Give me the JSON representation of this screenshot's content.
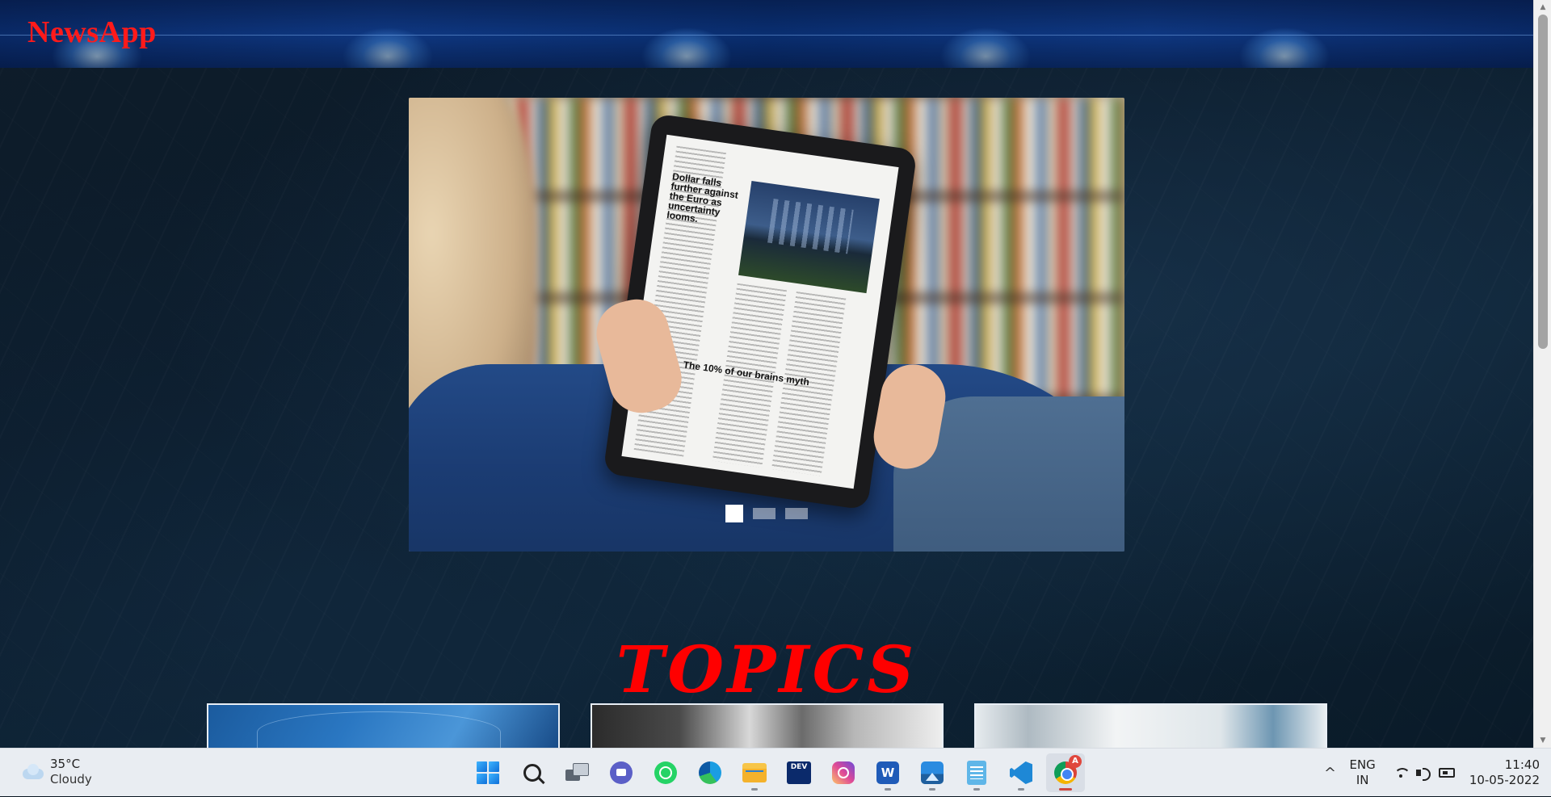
{
  "navbar": {
    "brand": "NewsApp"
  },
  "carousel": {
    "slide_headline_1": "Dollar falls further against the Euro as uncertainty looms.",
    "slide_headline_2": "The 10% of our brains myth",
    "slide_count": 3,
    "active_slide": 1
  },
  "topics": {
    "title": "TOPICS"
  },
  "taskbar": {
    "weather": {
      "temp": "35°C",
      "condition": "Cloudy",
      "icon": "cloud-icon"
    },
    "apps": [
      {
        "name": "start",
        "icon": "windows-icon"
      },
      {
        "name": "search",
        "icon": "search-icon"
      },
      {
        "name": "task-view",
        "icon": "task-view-icon"
      },
      {
        "name": "teams-chat",
        "icon": "chat-icon"
      },
      {
        "name": "whatsapp",
        "icon": "whatsapp-icon"
      },
      {
        "name": "edge",
        "icon": "edge-icon"
      },
      {
        "name": "file-explorer",
        "icon": "folder-icon"
      },
      {
        "name": "dev-home",
        "icon": "dev-icon",
        "label": "DEV"
      },
      {
        "name": "instagram",
        "icon": "instagram-icon"
      },
      {
        "name": "word",
        "icon": "word-icon",
        "label": "W"
      },
      {
        "name": "photos",
        "icon": "photos-icon"
      },
      {
        "name": "notepad",
        "icon": "notepad-icon"
      },
      {
        "name": "vscode",
        "icon": "vscode-icon"
      },
      {
        "name": "chrome",
        "icon": "chrome-icon",
        "badge": "A"
      }
    ],
    "tray": {
      "chevron": "^",
      "language": "ENG",
      "region": "IN",
      "time": "11:40",
      "date": "10-05-2022"
    }
  },
  "colors": {
    "brand_red": "#ff1a1a",
    "topics_red": "#ff0000",
    "page_bg": "#0b1a28"
  }
}
